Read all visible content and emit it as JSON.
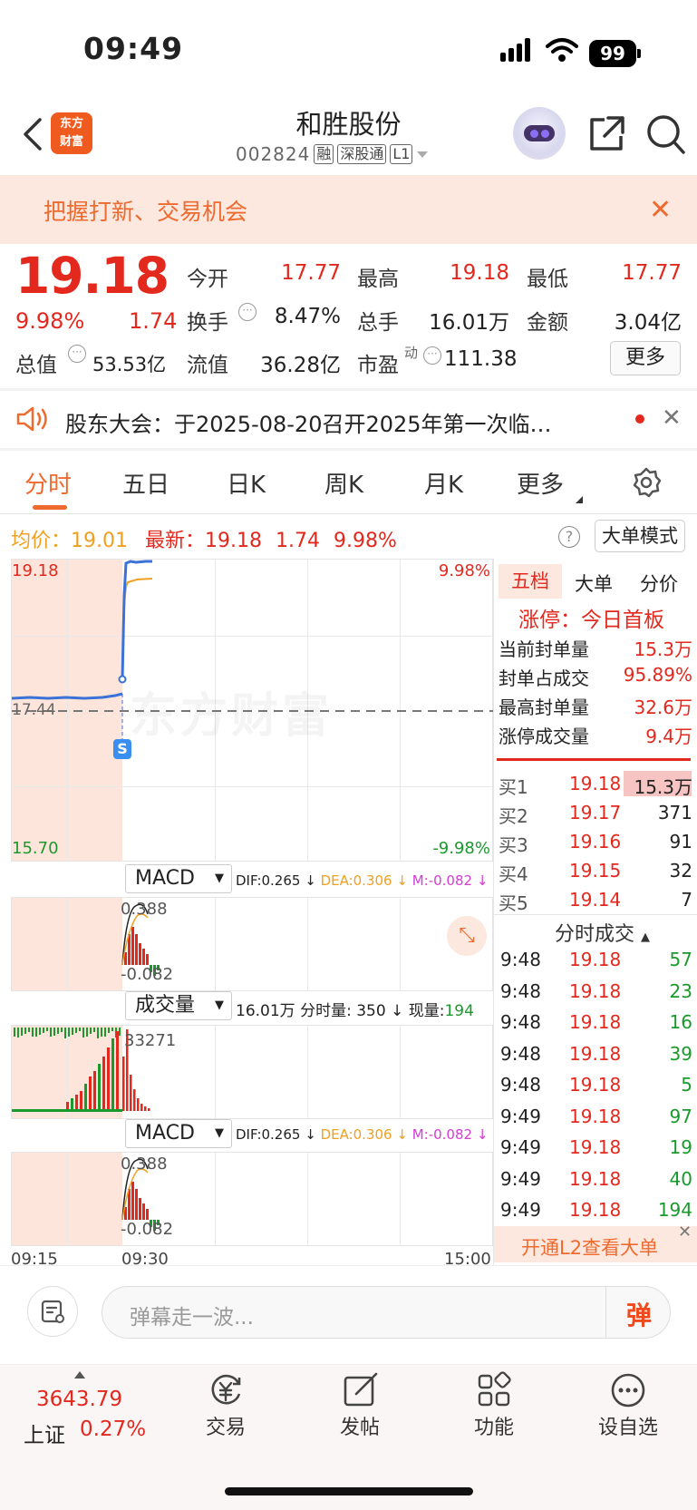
{
  "status": {
    "time": "09:49",
    "battery": "99"
  },
  "header": {
    "logo_line1": "东方",
    "logo_line2": "财富",
    "stock_name": "和胜股份",
    "stock_code": "002824",
    "tags": [
      "融",
      "深股通",
      "L1"
    ]
  },
  "banner": {
    "text": "把握打新、交易机会"
  },
  "quote": {
    "price": "19.18",
    "change_pct": "9.98%",
    "change": "1.74",
    "open_label": "今开",
    "open": "17.77",
    "high_label": "最高",
    "high": "19.18",
    "low_label": "最低",
    "low": "17.77",
    "turnover_label": "换手",
    "turnover": "8.47%",
    "volume_label": "总手",
    "volume": "16.01万",
    "amount_label": "金额",
    "amount": "3.04亿",
    "mcap_label": "总值",
    "mcap": "53.53亿",
    "float_label": "流值",
    "float_mcap": "36.28亿",
    "pe_label": "市盈",
    "pe_sup": "动",
    "pe": "111.38",
    "more": "更多"
  },
  "notice": {
    "text": "股东大会：于2025-08-20召开2025年第一次临…"
  },
  "tabs": [
    "分时",
    "五日",
    "日K",
    "周K",
    "月K",
    "更多"
  ],
  "info_line": {
    "avg_label": "均价：",
    "avg": "19.01",
    "latest_label": "最新：",
    "latest": "19.18",
    "change": "1.74",
    "pct": "9.98%",
    "big_order_btn": "大单模式"
  },
  "chart": {
    "y_top": "19.18",
    "y_mid": "17.44",
    "y_bottom": "15.70",
    "pct_top": "9.98%",
    "pct_bottom": "-9.98%",
    "watermark": "东方财富",
    "s_marker": "S",
    "time_start": "09:15",
    "time_mid": "09:30",
    "time_end": "15:00"
  },
  "macd": {
    "label": "MACD",
    "dif": "DIF:0.265 ↓",
    "dea": "DEA:0.306 ↓",
    "m": "M:-0.082 ↓",
    "top": "0.388",
    "bottom": "-0.082"
  },
  "volume_panel": {
    "label": "成交量",
    "total": "16.01万",
    "fs_label": "分时量: 350 ↓",
    "now_label": "现量:",
    "now": "194",
    "top": "33271"
  },
  "right_panel": {
    "tabs": [
      "五档",
      "大单",
      "分价"
    ],
    "limit_title": "涨停：今日首板",
    "stats": [
      {
        "label": "当前封单量",
        "value": "15.3万"
      },
      {
        "label": "封单占成交",
        "value": "95.89%"
      },
      {
        "label": "最高封单量",
        "value": "32.6万"
      },
      {
        "label": "涨停成交量",
        "value": "9.4万"
      }
    ],
    "bids": [
      {
        "label": "买1",
        "price": "19.18",
        "vol": "15.3万"
      },
      {
        "label": "买2",
        "price": "19.17",
        "vol": "371"
      },
      {
        "label": "买3",
        "price": "19.16",
        "vol": "91"
      },
      {
        "label": "买4",
        "price": "19.15",
        "vol": "32"
      },
      {
        "label": "买5",
        "price": "19.14",
        "vol": "7"
      }
    ],
    "trades_title": "分时成交",
    "trades": [
      {
        "time": "9:48",
        "price": "19.18",
        "vol": "57"
      },
      {
        "time": "9:48",
        "price": "19.18",
        "vol": "23"
      },
      {
        "time": "9:48",
        "price": "19.18",
        "vol": "16"
      },
      {
        "time": "9:48",
        "price": "19.18",
        "vol": "39"
      },
      {
        "time": "9:48",
        "price": "19.18",
        "vol": "5"
      },
      {
        "time": "9:49",
        "price": "19.18",
        "vol": "97"
      },
      {
        "time": "9:49",
        "price": "19.18",
        "vol": "19"
      },
      {
        "time": "9:49",
        "price": "19.18",
        "vol": "40"
      },
      {
        "time": "9:49",
        "price": "19.18",
        "vol": "194"
      }
    ],
    "l2_banner": "开通L2查看大单"
  },
  "comment": {
    "placeholder": "弹幕走一波...",
    "danmu_icon": "弹"
  },
  "nav": {
    "index_value": "3643.79",
    "index_name": "上证",
    "index_pct": "0.27%",
    "items": [
      "交易",
      "发帖",
      "功能",
      "设自选"
    ]
  },
  "colors": {
    "up": "#e3281e",
    "down": "#1a9a2c",
    "accent": "#ef6a2e",
    "avg_line": "#f0a020",
    "price_line": "#3a72d8"
  }
}
